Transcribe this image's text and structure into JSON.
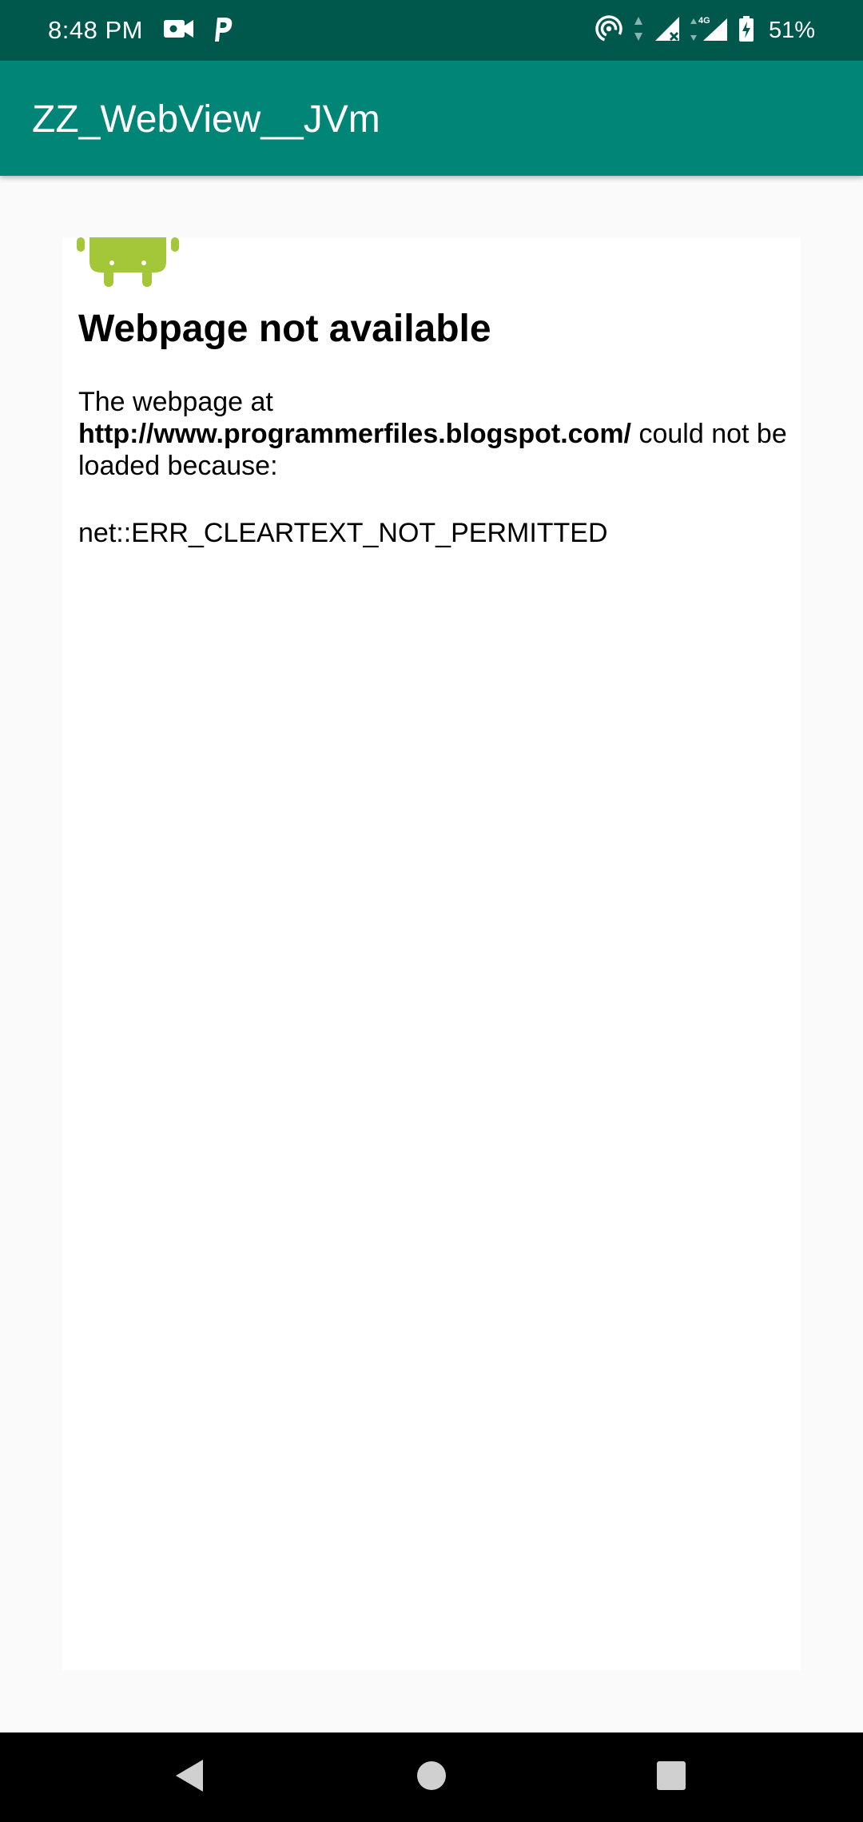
{
  "status_bar": {
    "time": "8:48 PM",
    "battery": "51%",
    "icons_left": [
      "video-camera-icon",
      "parking-icon"
    ],
    "icons_right": [
      "hotspot-icon",
      "data-activity-icon",
      "signal-no-service-icon",
      "signal-4g-icon",
      "battery-icon"
    ],
    "network_type": "4G"
  },
  "app_bar": {
    "title": "ZZ_WebView__JVm",
    "color": "#008577"
  },
  "webview": {
    "heading": "Webpage not available",
    "body_prefix": "The webpage at",
    "url": "http://www.programmerfiles.blogspot.com/",
    "body_suffix": "could not be loaded because:",
    "error_code": "net::ERR_CLEARTEXT_NOT_PERMITTED",
    "logo": "android-logo-icon",
    "logo_color": "#a4c639"
  },
  "nav_bar": {
    "buttons": [
      "back-icon",
      "home-icon",
      "recents-icon"
    ]
  }
}
